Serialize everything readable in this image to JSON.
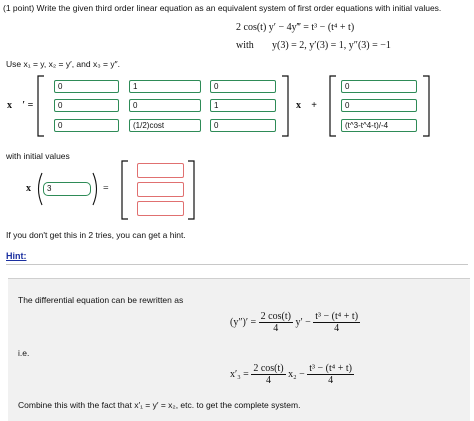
{
  "problem": {
    "intro": "(1 point) Write the given third order linear equation as an equivalent system of first order equations with initial values.",
    "equation_lhs": "2 cos(t) y′ − 4y‴ = t³ − (t⁴ + t)",
    "with_label": "with",
    "initial_conditions": "y(3) = 2,  y′(3) = 1,  y″(3) = −1"
  },
  "substitution_text": "Use x₁ = y, x₂ = y′, and x₃ = y″.",
  "matrix": {
    "lhs_label": "x⃗ ′ =",
    "cells": [
      [
        "0",
        "1",
        "0"
      ],
      [
        "0",
        "0",
        "1"
      ],
      [
        "0",
        "(1/2)cost",
        "0"
      ]
    ],
    "times_label": "x⃗ +",
    "vector": [
      "0",
      "0",
      "(t^3-t^4-t)/-4"
    ]
  },
  "initial_values": {
    "label": "with initial values",
    "x_label": "x⃗",
    "arg_value": "3",
    "equals": "=",
    "result": [
      "",
      "",
      ""
    ]
  },
  "hint_notice": "If you don't get this in 2 tries, you can get a hint.",
  "hint_label": "Hint:",
  "hint": {
    "line1": "The differential equation can be rewritten as",
    "eq1_lhs": "(y″)′ =",
    "eq1_frac1_num": "2 cos(t)",
    "eq1_frac1_den": "4",
    "eq1_mid": "y′ −",
    "eq1_frac2_num": "t³ − (t⁴ + t)",
    "eq1_frac2_den": "4",
    "ie": "i.e.",
    "eq2_lhs": "x′₃ =",
    "eq2_frac1_num": "2 cos(t)",
    "eq2_frac1_den": "4",
    "eq2_mid": "x₂ −",
    "eq2_frac2_num": "t³ − (t⁴ + t)",
    "eq2_frac2_den": "4",
    "final": "Combine this with the fact that x′₁ = y′ = x₂, etc. to get the complete system."
  }
}
